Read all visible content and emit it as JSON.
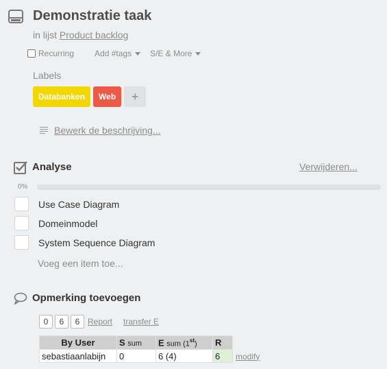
{
  "card": {
    "title": "Demonstratie taak",
    "in_list_prefix": "in lijst",
    "list_name": "Product backlog"
  },
  "options": {
    "recurring": "Recurring",
    "add_tags": "Add #tags",
    "se_more": "S/E & More"
  },
  "labels": {
    "heading": "Labels",
    "items": [
      {
        "text": "Databanken",
        "color": "#f2d600"
      },
      {
        "text": "Web",
        "color": "#eb5a46"
      }
    ],
    "add_symbol": "+"
  },
  "description": {
    "edit_link": "Bewerk de beschrijving..."
  },
  "checklist": {
    "title": "Analyse",
    "delete_link": "Verwijderen...",
    "progress_label": "0%",
    "progress": 0,
    "items": [
      {
        "label": "Use Case Diagram",
        "checked": false
      },
      {
        "label": "Domeinmodel",
        "checked": false
      },
      {
        "label": "System Sequence Diagram",
        "checked": false
      }
    ],
    "add_item": "Voeg een item toe..."
  },
  "comment": {
    "title": "Opmerking toevoegen"
  },
  "plus_scrum": {
    "counters": [
      "0",
      "6",
      "6"
    ],
    "report_link": "Report",
    "transfer_link": "transfer E",
    "table": {
      "headers": {
        "user": "By User",
        "s": "S",
        "s_sum": "sum",
        "e": "E",
        "e_sum": "sum (1",
        "e_sup": "st",
        "e_close": ")",
        "r": "R"
      },
      "rows": [
        {
          "user": "sebastiaanlabijn",
          "s": "0",
          "e": "6 (4)",
          "r": "6",
          "action": "modify"
        }
      ]
    }
  }
}
